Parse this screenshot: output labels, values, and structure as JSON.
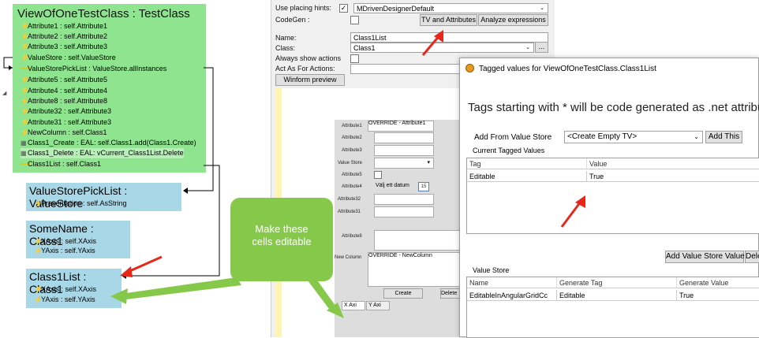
{
  "main_class": {
    "title": "ViewOfOneTestClass : TestClass",
    "rows": [
      {
        "icon": "⚡",
        "text": "Attribute1 : self.Attribute1"
      },
      {
        "icon": "⚡",
        "text": "Attribute2 : self.Attribute2"
      },
      {
        "icon": "⚡",
        "text": "Attribute3 : self.Attribute3"
      },
      {
        "icon": "⚡",
        "text": "ValueStore : self.ValueStore"
      },
      {
        "icon": "⟶",
        "text": "ValueStorePickList : ValueStore.allInstances"
      },
      {
        "icon": "⚡",
        "text": "Attribute5 : self.Attribute5"
      },
      {
        "icon": "⚡",
        "text": "Attribute4 : self.Attribute4"
      },
      {
        "icon": "⚡",
        "text": "Attribute8 : self.Attribute8"
      },
      {
        "icon": "⚡",
        "text": "Attribute32 : self.Attribute3"
      },
      {
        "icon": "⚡",
        "text": "Attribute31 : self.Attribute3"
      },
      {
        "icon": "⚡",
        "text": "NewColumn : self.Class1"
      },
      {
        "icon": "▦",
        "text": "Class1_Create : EAL: self.Class1.add(Class1.Create)"
      },
      {
        "icon": "▦",
        "text": "Class1_Delete : EAL: vCurrent_Class1List.Delete"
      },
      {
        "icon": "⟶",
        "text": "Class1List : self.Class1"
      }
    ]
  },
  "vs_picklist": {
    "title": "ValueStorePickList : ValueStore",
    "rows": [
      {
        "icon": "⚡",
        "text": "Presentation : self.AsString"
      }
    ]
  },
  "somename": {
    "title": "SomeName : Class1",
    "rows": [
      {
        "icon": "⚡",
        "text": "XAxis : self.XAxis"
      },
      {
        "icon": "⚡",
        "text": "YAxis : self.YAxis"
      }
    ]
  },
  "class1list": {
    "title": "Class1List : Class1",
    "rows": [
      {
        "icon": "⚡",
        "text": "XAxis : self.XAxis"
      },
      {
        "icon": "⚡",
        "text": "YAxis : self.YAxis"
      }
    ]
  },
  "callout": {
    "line1": "Make these",
    "line2": "cells editable"
  },
  "props": {
    "use_placing_hints_label": "Use placing hints:",
    "use_placing_hints_checked": "✓",
    "placing_hints_value": "MDrivenDesignerDefault",
    "codegen_label": "CodeGen :",
    "tv_button": "TV and Attributes",
    "analyze_button": "Analyze expressions",
    "name_label": "Name:",
    "name_value": "Class1List",
    "class_label": "Class:",
    "class_value": "Class1",
    "ellipsis": "...",
    "always_show_label": "Always show actions",
    "act_as_label": "Act As For Actions:",
    "winform_button": "Winform preview"
  },
  "form": {
    "labels": [
      "Attribute1",
      "Attribute2",
      "Attribute3",
      "Value Store",
      "Attribute5",
      "Attribute4",
      "Attribute32",
      "Attribute31",
      "Attribute8",
      "New Column"
    ],
    "override1": "OVERRIDE - Attribute1",
    "override2": "OVERRIDE - NewColumn",
    "date_text": "Välj ett datum",
    "date_icon": "15",
    "create_button": "Create",
    "delete_button": "Delete",
    "tabs": [
      "X Axi",
      "Y Axi"
    ]
  },
  "dialog": {
    "title": "Tagged values for ViewOfOneTestClass.Class1List",
    "heading": "Tags starting with * will be code generated as .net attribu",
    "add_from_label": "Add From Value Store",
    "create_empty": "<Create Empty TV>",
    "add_this": "Add This",
    "current_label": "Current Tagged Values",
    "tv_headers": [
      "Tag",
      "Value"
    ],
    "tv_rows": [
      {
        "tag": "Editable",
        "value": "True"
      }
    ],
    "add_vs_value": "Add Value Store Value",
    "dele": "Dele",
    "vs_label": "Value Store",
    "vs_headers": [
      "Name",
      "Generate Tag",
      "Generate Value"
    ],
    "vs_rows": [
      {
        "name": "EditableInAngularGridCc",
        "tag": "Editable",
        "value": "True"
      }
    ]
  },
  "colors": {
    "green_box": "#8fe58f",
    "blue_box": "#a8d8e8",
    "callout": "#86c94a",
    "arrow_red": "#e8271b"
  }
}
